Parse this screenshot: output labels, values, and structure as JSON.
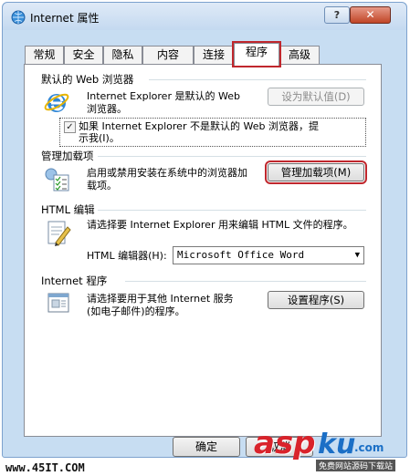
{
  "window": {
    "title": "Internet 属性",
    "help_label": "?",
    "close_label": "✕"
  },
  "tabs": [
    {
      "label": "常规"
    },
    {
      "label": "安全"
    },
    {
      "label": "隐私"
    },
    {
      "label": "内容"
    },
    {
      "label": "连接"
    },
    {
      "label": "程序",
      "active": true
    },
    {
      "label": "高级"
    }
  ],
  "default_browser": {
    "heading": "默认的 Web 浏览器",
    "text_line1": "Internet Explorer 是默认的 Web",
    "text_line2": "浏览器。",
    "button_label": "设为默认值(D)",
    "checkbox_checked": true,
    "checkbox_line1": "如果 Internet Explorer 不是默认的 Web 浏览器，提",
    "checkbox_line2": "示我(I)。",
    "icon": "ie-logo-icon"
  },
  "addons": {
    "heading": "管理加载项",
    "text_line1": "启用或禁用安装在系统中的浏览器加",
    "text_line2": "载项。",
    "button_label": "管理加载项(M)",
    "icon": "addons-checklist-icon"
  },
  "html_editor": {
    "heading": "HTML 编辑",
    "text": "请选择要 Internet Explorer 用来编辑 HTML 文件的程序。",
    "select_label": "HTML 编辑器(H):",
    "select_value": "Microsoft Office Word",
    "icon": "html-editor-icon"
  },
  "internet_programs": {
    "heading": "Internet 程序",
    "text_line1": "请选择要用于其他 Internet 服务",
    "text_line2": "(如电子邮件)的程序。",
    "button_label": "设置程序(S)",
    "icon": "programs-window-icon"
  },
  "footer": {
    "ok_label": "确定",
    "cancel_label": "取消"
  },
  "watermark": {
    "left": "www.45IT.COM",
    "asp": "asp",
    "ku": "ku",
    "com": ".com",
    "sub": "免费网站源码下载站"
  },
  "colors": {
    "highlight": "#c0272d",
    "window_frame": "#c7ddf2",
    "close_button": "#c04426"
  }
}
